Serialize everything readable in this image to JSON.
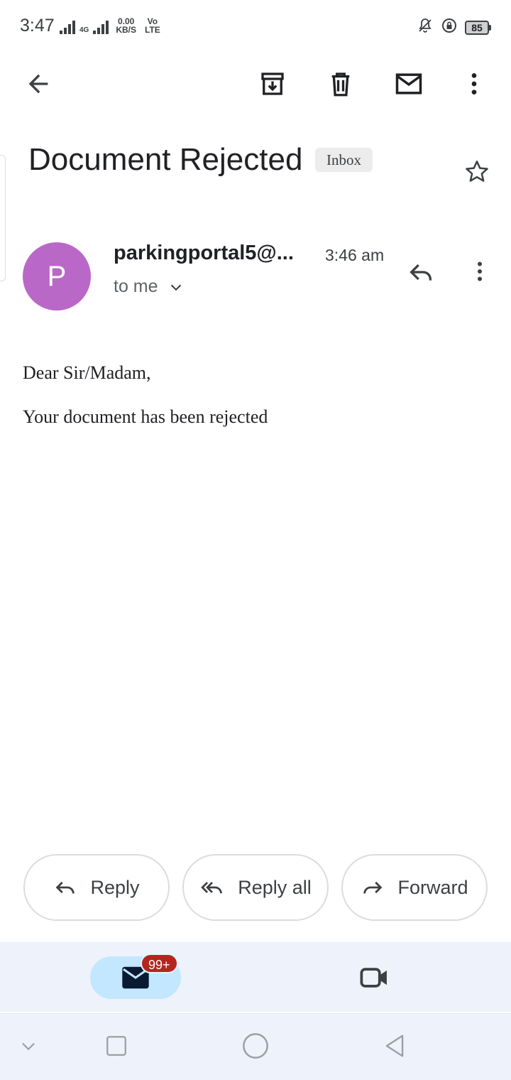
{
  "status_bar": {
    "time": "3:47",
    "network_type": "4G",
    "speed_value": "0.00",
    "speed_unit": "KB/S",
    "volte_top": "Vo",
    "volte_bottom": "LTE",
    "battery": "85"
  },
  "toolbar": {
    "icons": [
      "back-arrow-icon",
      "archive-icon",
      "delete-icon",
      "mark-unread-icon",
      "more-vert-icon"
    ]
  },
  "email": {
    "subject": "Document Rejected",
    "label": "Inbox",
    "sender_initial": "P",
    "sender": "parkingportal5@...",
    "time": "3:46 am",
    "recipient": "to me",
    "avatar_color": "#ba68c8",
    "body": {
      "greeting": "Dear Sir/Madam,",
      "message": "Your document has been rejected"
    }
  },
  "actions": {
    "reply": "Reply",
    "reply_all": "Reply all",
    "forward": "Forward"
  },
  "bottom_nav": {
    "mail_badge": "99+",
    "active_color": "#c2e7ff",
    "badge_color": "#b3261e"
  }
}
